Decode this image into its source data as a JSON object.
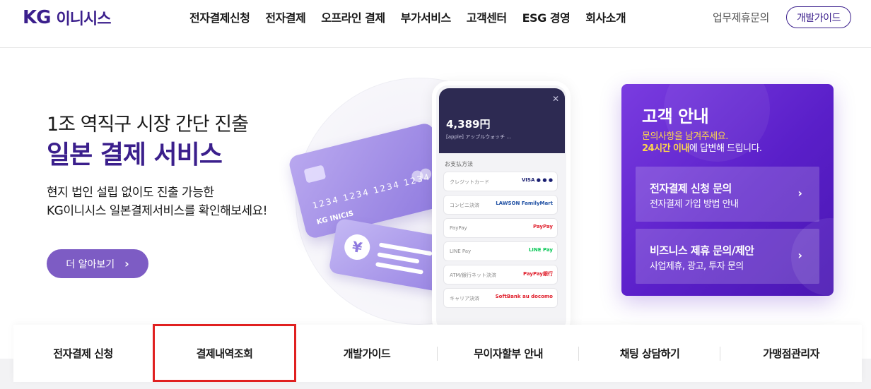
{
  "header": {
    "logo_mark": "KG",
    "logo_text": "이니시스",
    "nav": [
      "전자결제신청",
      "전자결제",
      "오프라인 결제",
      "부가서비스",
      "고객센터",
      "ESG 경영",
      "회사소개"
    ],
    "partner_link": "업무제휴문의",
    "dev_guide": "개발가이드"
  },
  "hero": {
    "line1": "1조 역직구 시장 간단 진출",
    "line2": "일본 결제 서비스",
    "desc_line1": "현지 법인 설립 없이도 진출 가능한",
    "desc_line2": "KG이니시스 일본결제서비스를 확인해보세요!",
    "cta": "더 알아보기"
  },
  "illustration": {
    "card_number": "1234  1234  1234  1234",
    "card_brand": "KG INICIS",
    "yen_symbol": "¥",
    "phone_amount": "4,389円",
    "phone_product": "[apple] アップルウォッチ …",
    "payment_method_label": "お支払方法",
    "methods": [
      {
        "name": "クレジットカード",
        "logo": "VISA ● ● ●"
      },
      {
        "name": "コンビニ決済",
        "logo": "LAWSON FamilyMart"
      },
      {
        "name": "PayPay",
        "logo": "PayPay"
      },
      {
        "name": "LINE Pay",
        "logo": "LINE Pay"
      },
      {
        "name": "ATM/銀行ネット決済",
        "logo": "PayPay銀行"
      },
      {
        "name": "キャリア決済",
        "logo": "SoftBank au docomo"
      }
    ]
  },
  "customer_panel": {
    "title": "고객 안내",
    "sub1": "문의사항을 남겨주세요.",
    "sub2_bold": "24시간 이내",
    "sub2_rest": "에 답변해 드립니다.",
    "buttons": [
      {
        "title": "전자결제 신청 문의",
        "desc": "전자결제 가입 방법 안내"
      },
      {
        "title": "비즈니스 제휴 문의/제안",
        "desc": "사업제휴, 광고, 투자 문의"
      }
    ]
  },
  "quick_menu": [
    "전자결제 신청",
    "결제내역조회",
    "개발가이드",
    "무이자할부 안내",
    "채팅 상담하기",
    "가맹점관리자"
  ],
  "colors": {
    "brand": "#3b1f8c",
    "accent_purple": "#5a1fc9",
    "cta_bg": "#7d5cc4",
    "highlight": "#e02020",
    "yellow": "#ffd84a"
  }
}
